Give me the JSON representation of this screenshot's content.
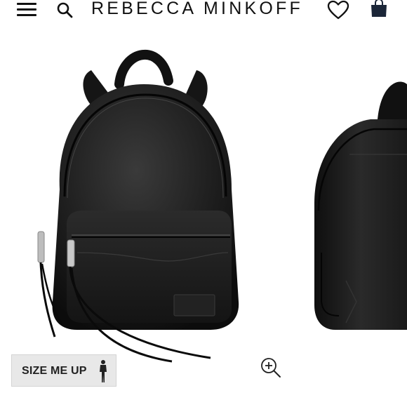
{
  "header": {
    "brand": "REBECCA MINKOFF",
    "icons": [
      "menu-icon",
      "search-icon",
      "heart-icon",
      "shopping-bag-icon"
    ]
  },
  "product_gallery": {
    "images": [
      "backpack-front",
      "backpack-side"
    ],
    "size_button_label": "SIZE ME UP",
    "zoom_icon": "zoom-in-icon"
  },
  "colors": {
    "brand_text": "#111111",
    "bag_icon": "#1b2638",
    "button_bg": "#e8e8e8"
  }
}
